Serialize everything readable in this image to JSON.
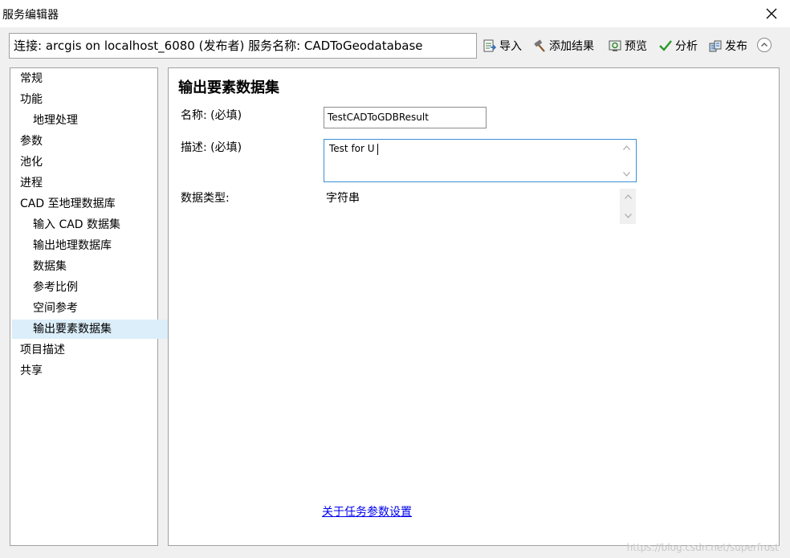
{
  "window": {
    "title": "服务编辑器"
  },
  "connection_bar": {
    "text": "连接: arcgis on localhost_6080 (发布者)   服务名称: CADToGeodatabase"
  },
  "toolbar": {
    "import_label": "导入",
    "add_result_label": "添加结果",
    "preview_label": "预览",
    "analyze_label": "分析",
    "publish_label": "发布"
  },
  "sidebar": {
    "items": [
      {
        "label": "常规"
      },
      {
        "label": "功能"
      },
      {
        "label": "地理处理"
      },
      {
        "label": "参数"
      },
      {
        "label": "池化"
      },
      {
        "label": "进程"
      },
      {
        "label": "CAD 至地理数据库"
      },
      {
        "label": "输入 CAD 数据集"
      },
      {
        "label": "输出地理数据库"
      },
      {
        "label": "数据集"
      },
      {
        "label": "参考比例"
      },
      {
        "label": "空间参考"
      },
      {
        "label": "输出要素数据集"
      },
      {
        "label": "项目描述"
      },
      {
        "label": "共享"
      }
    ],
    "selected": "输出要素数据集"
  },
  "main": {
    "title": "输出要素数据集",
    "name_label": "名称: (必填)",
    "name_value": "TestCADToGDBResult",
    "description_label": "描述: (必填)",
    "description_value": "Test for U",
    "datatype_label": "数据类型:",
    "datatype_value": "字符串",
    "help_link": "关于任务参数设置"
  },
  "watermark": "https://blog.csdn.net/superfrost"
}
